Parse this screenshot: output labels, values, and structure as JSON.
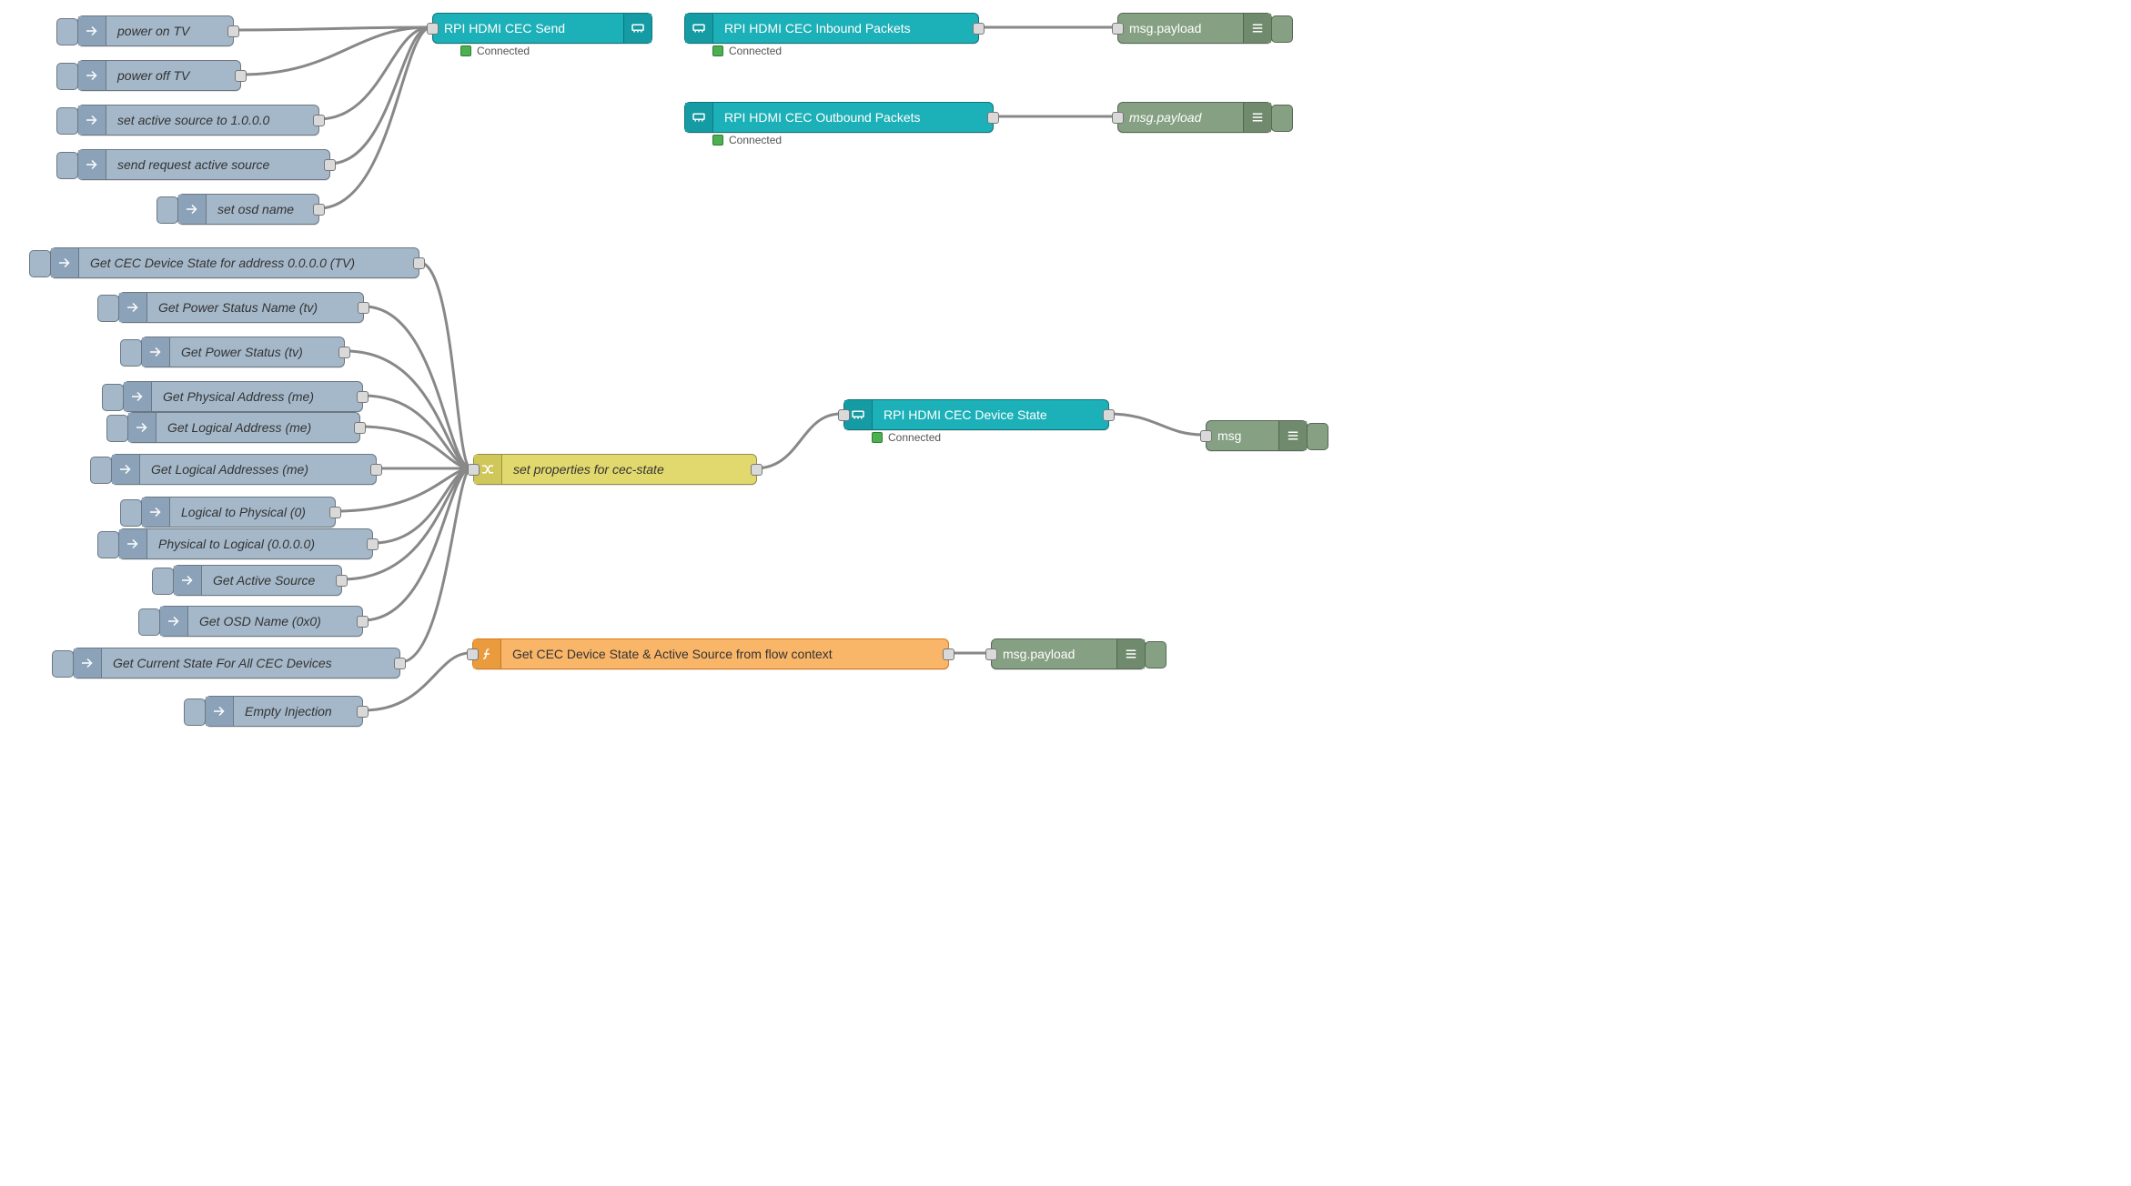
{
  "status_text": "Connected",
  "nodes": {
    "inj_power_on": {
      "label": "power on TV"
    },
    "inj_power_off": {
      "label": "power off TV"
    },
    "inj_set_active": {
      "label": "set active source to 1.0.0.0"
    },
    "inj_req_active": {
      "label": "send request active source"
    },
    "inj_osd": {
      "label": "set osd name"
    },
    "inj_dev_state": {
      "label": "Get CEC Device State for address 0.0.0.0 (TV)"
    },
    "inj_pstat_name": {
      "label": "Get Power Status Name (tv)"
    },
    "inj_pstat": {
      "label": "Get Power Status (tv)"
    },
    "inj_phys_me": {
      "label": "Get Physical Address (me)"
    },
    "inj_log_me": {
      "label": "Get Logical Address (me)"
    },
    "inj_logs_me": {
      "label": "Get Logical Addresses (me)"
    },
    "inj_l2p": {
      "label": "Logical to Physical (0)"
    },
    "inj_p2l": {
      "label": "Physical to Logical (0.0.0.0)"
    },
    "inj_act_src": {
      "label": "Get Active Source"
    },
    "inj_osd_name": {
      "label": "Get OSD Name (0x0)"
    },
    "inj_all_state": {
      "label": "Get Current State For All CEC Devices"
    },
    "inj_empty": {
      "label": "Empty Injection"
    },
    "cec_send": {
      "label": "RPI HDMI CEC Send"
    },
    "cec_in": {
      "label": "RPI HDMI CEC Inbound Packets"
    },
    "cec_out": {
      "label": "RPI HDMI CEC Outbound Packets"
    },
    "cec_state": {
      "label": "RPI HDMI CEC Device State"
    },
    "change_props": {
      "label": "set properties for cec-state"
    },
    "func_ctx": {
      "label": "Get CEC Device State & Active Source from flow context"
    },
    "dbg_in": {
      "label": "msg.payload"
    },
    "dbg_out": {
      "label": "msg.payload"
    },
    "dbg_state": {
      "label": "msg"
    },
    "dbg_ctx": {
      "label": "msg.payload"
    }
  }
}
